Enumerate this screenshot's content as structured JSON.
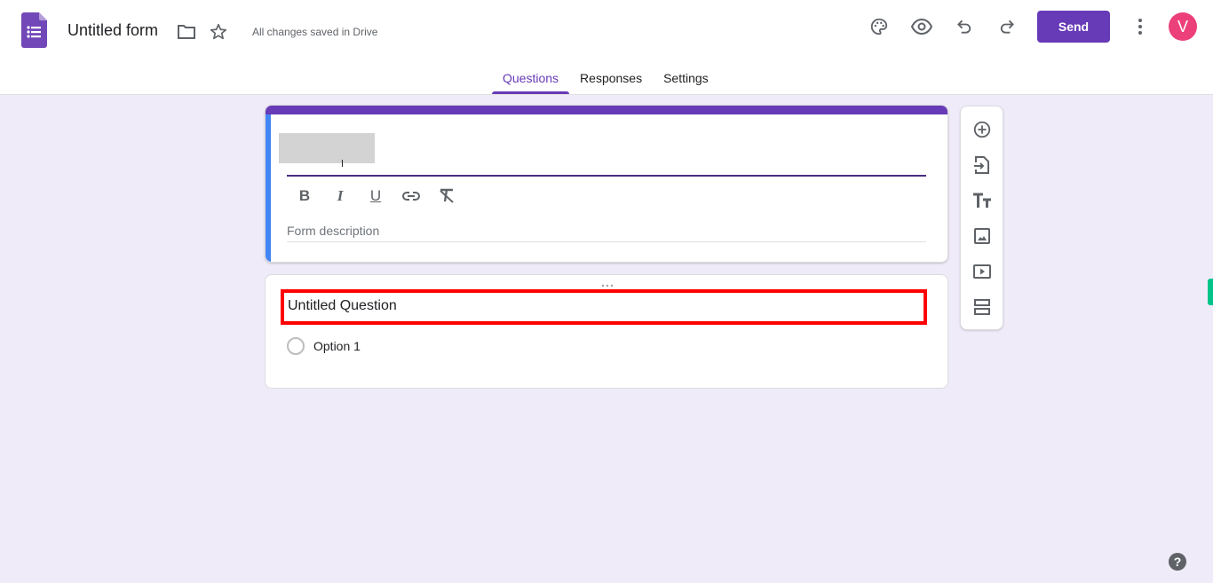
{
  "header": {
    "app_icon": "google-forms-icon",
    "title": "Untitled form",
    "folder_icon": "folder-icon",
    "star_icon": "star-icon",
    "save_status": "All changes saved in Drive",
    "actions": {
      "palette_icon": "palette-icon",
      "preview_icon": "eye-icon",
      "undo_icon": "undo-icon",
      "redo_icon": "redo-icon",
      "send_label": "Send",
      "more_icon": "more-vert-icon",
      "avatar_initial": "V"
    },
    "brand_color": "#673ab7",
    "avatar_color": "#ec407a"
  },
  "tabs": [
    {
      "label": "Questions",
      "active": true
    },
    {
      "label": "Responses",
      "active": false
    },
    {
      "label": "Settings",
      "active": false
    }
  ],
  "form_header": {
    "title_value": "",
    "title_redacted": true,
    "format_toolbar": [
      {
        "name": "bold",
        "glyph": "B"
      },
      {
        "name": "italic",
        "glyph": "I"
      },
      {
        "name": "underline",
        "glyph": "U"
      },
      {
        "name": "link",
        "glyph": "link"
      },
      {
        "name": "clear-formatting",
        "glyph": "clear"
      }
    ],
    "description_placeholder": "Form description"
  },
  "question": {
    "title": "Untitled Question",
    "options": [
      {
        "label": "Option 1",
        "type": "radio"
      }
    ]
  },
  "side_toolbar": [
    {
      "name": "add-question",
      "icon": "add-circle-icon"
    },
    {
      "name": "import-questions",
      "icon": "import-icon"
    },
    {
      "name": "add-title-description",
      "icon": "title-icon"
    },
    {
      "name": "add-image",
      "icon": "image-icon"
    },
    {
      "name": "add-video",
      "icon": "video-icon"
    },
    {
      "name": "add-section",
      "icon": "section-icon"
    }
  ],
  "help_label": "?"
}
